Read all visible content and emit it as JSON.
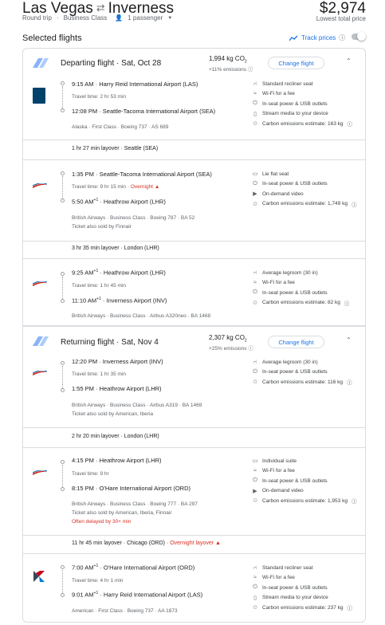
{
  "header": {
    "origin": "Las Vegas",
    "destination": "Inverness",
    "trip_type": "Round trip",
    "cabin": "Business Class",
    "passengers": "1 passenger",
    "price": "$2,974",
    "price_note": "Lowest total price"
  },
  "selected_title": "Selected flights",
  "track_prices": "Track prices",
  "departing": {
    "title": "Departing flight",
    "date": "Sat, Oct 28",
    "co2": "1,994 kg CO",
    "co2_sub": "2",
    "emissions": "+11% emissions",
    "change": "Change flight",
    "seg1": {
      "dep_time": "9:15 AM",
      "dep_airport": "Harry Reid International Airport (LAS)",
      "travel": "Travel time: 2 hr 53 min",
      "arr_time": "12:08 PM",
      "arr_airport": "Seattle-Tacoma International Airport (SEA)",
      "info": "Alaska · First Class · Boeing 737 · AS 689",
      "amenities": [
        "Standard recliner seat",
        "Wi-Fi for a fee",
        "In-seat power & USB outlets",
        "Stream media to your device",
        "Carbon emissions estimate: 163 kg"
      ]
    },
    "layover1": "1 hr 27 min layover · Seattle (SEA)",
    "seg2": {
      "dep_time": "1:35 PM",
      "dep_airport": "Seattle-Tacoma International Airport (SEA)",
      "travel": "Travel time: 9 hr 15 min",
      "overnight": "Overnight",
      "arr_time": "5:50 AM",
      "arr_sup": "+1",
      "arr_airport": "Heathrow Airport (LHR)",
      "info": "British Airways · Business Class · Boeing 787 · BA 52",
      "sold": "Ticket also sold by Finnair",
      "amenities": [
        "Lie flat seat",
        "In-seat power & USB outlets",
        "On-demand video",
        "Carbon emissions estimate: 1,749 kg"
      ]
    },
    "layover2": "3 hr 35 min layover · London (LHR)",
    "seg3": {
      "dep_time": "9:25 AM",
      "dep_sup": "+1",
      "dep_airport": "Heathrow Airport (LHR)",
      "travel": "Travel time: 1 hr 45 min",
      "arr_time": "11:10 AM",
      "arr_sup": "+1",
      "arr_airport": "Inverness Airport (INV)",
      "info": "British Airways · Business Class · Airbus A320neo · BA 1468",
      "amenities": [
        "Average legroom (30 in)",
        "Wi-Fi for a fee",
        "In-seat power & USB outlets",
        "Carbon emissions estimate: 82 kg"
      ]
    }
  },
  "returning": {
    "title": "Returning flight",
    "date": "Sat, Nov 4",
    "co2": "2,307 kg CO",
    "co2_sub": "2",
    "emissions": "+25% emissions",
    "change": "Change flight",
    "seg1": {
      "dep_time": "12:20 PM",
      "dep_airport": "Inverness Airport (INV)",
      "travel": "Travel time: 1 hr 35 min",
      "arr_time": "1:55 PM",
      "arr_airport": "Heathrow Airport (LHR)",
      "info": "British Airways · Business Class · Airbus A319 · BA 1469",
      "sold": "Ticket also sold by American, Iberia",
      "amenities": [
        "Average legroom (30 in)",
        "In-seat power & USB outlets",
        "Carbon emissions estimate: 116 kg"
      ]
    },
    "layover1": "2 hr 20 min layover · London (LHR)",
    "seg2": {
      "dep_time": "4:15 PM",
      "dep_airport": "Heathrow Airport (LHR)",
      "travel": "Travel time: 9 hr",
      "arr_time": "8:15 PM",
      "arr_airport": "O'Hare International Airport (ORD)",
      "info": "British Airways · Business Class · Boeing 777 · BA 297",
      "sold": "Ticket also sold by American, Iberia, Finnair",
      "delay": "Often delayed by 30+ min",
      "amenities": [
        "Individual suite",
        "Wi-Fi for a fee",
        "In-seat power & USB outlets",
        "On-demand video",
        "Carbon emissions estimate: 1,953 kg"
      ]
    },
    "layover2": "11 hr 45 min layover · Chicago (ORD) · ",
    "layover2_warn": "Overnight layover",
    "seg3": {
      "dep_time": "7:00 AM",
      "dep_sup": "+1",
      "dep_airport": "O'Hare International Airport (ORD)",
      "travel": "Travel time: 4 hr 1 min",
      "arr_time": "9:01 AM",
      "arr_sup": "+1",
      "arr_airport": "Harry Reid International Airport (LAS)",
      "info": "American · First Class · Boeing 737 · AA 1873",
      "amenities": [
        "Standard recliner seat",
        "Wi-Fi for a fee",
        "In-seat power & USB outlets",
        "Stream media to your device",
        "Carbon emissions estimate: 237 kg"
      ]
    }
  },
  "colors": {
    "accent": "#1a73e8",
    "warning": "#d93025",
    "border": "#dadce0"
  }
}
